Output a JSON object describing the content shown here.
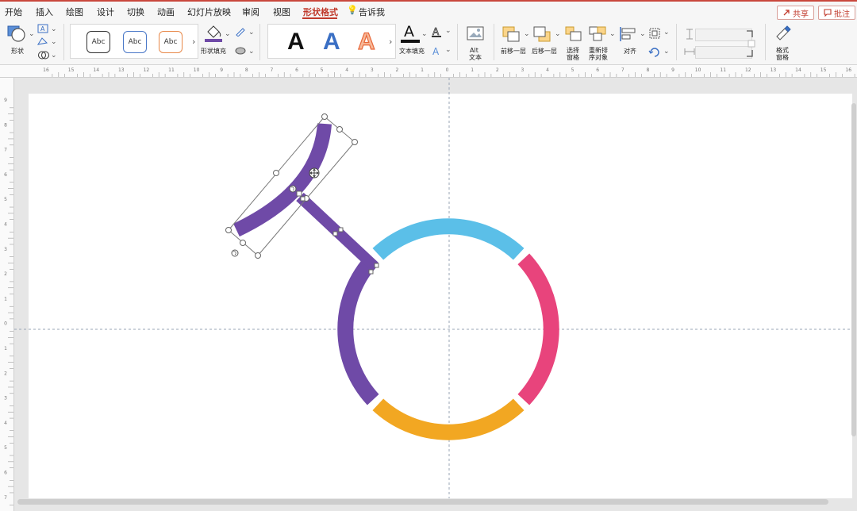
{
  "menu": {
    "items": [
      "开始",
      "插入",
      "绘图",
      "设计",
      "切换",
      "动画",
      "幻灯片放映",
      "审阅",
      "视图",
      "形状格式",
      "告诉我"
    ],
    "active": "形状格式",
    "share_label": "共享",
    "comment_label": "批注"
  },
  "ribbon": {
    "shape_label": "形状",
    "style_samples": [
      "Abc",
      "Abc",
      "Abc"
    ],
    "shape_fill_label": "形状填充",
    "wordart_letter": "A",
    "text_fill_label": "文本填充",
    "alt_text_label": [
      "Alt",
      "文本"
    ],
    "bring_forward_label": "前移一层",
    "send_backward_label": "后移一层",
    "selection_pane_label": [
      "选择",
      "窗格"
    ],
    "reorder_label": [
      "重新排",
      "序对象"
    ],
    "align_label": "对齐",
    "format_pane_label": [
      "格式",
      "窗格"
    ]
  },
  "ruler": {
    "h_numbers": [
      "16",
      "15",
      "14",
      "13",
      "12",
      "11",
      "10",
      "9",
      "8",
      "7",
      "6",
      "5",
      "4",
      "3",
      "2",
      "1",
      "0",
      "1",
      "2",
      "3",
      "4",
      "5",
      "6",
      "7",
      "8",
      "9",
      "10",
      "11",
      "12",
      "13",
      "14",
      "15",
      "16"
    ],
    "v_numbers": [
      "9",
      "8",
      "7",
      "6",
      "5",
      "4",
      "3",
      "2",
      "1",
      "0",
      "1",
      "2",
      "3",
      "4",
      "5",
      "6",
      "7",
      "8"
    ]
  },
  "colors": {
    "accent_red": "#c0392b",
    "purple": "#6f4aa7",
    "blue": "#5bbfe8",
    "pink": "#e8447c",
    "orange": "#f2a722"
  },
  "icons": [
    "shape-icon",
    "text-box-icon",
    "edit-shape-icon",
    "merge-shapes-icon",
    "paint-bucket-icon",
    "outline-pen-icon",
    "effects-icon",
    "text-outline-icon",
    "text-effects-icon",
    "alt-text-icon",
    "bring-forward-icon",
    "send-backward-icon",
    "selection-pane-icon",
    "reorder-icon",
    "align-icon",
    "group-icon",
    "rotate-icon",
    "format-pane-icon",
    "lightbulb-icon",
    "share-icon",
    "comment-icon"
  ]
}
